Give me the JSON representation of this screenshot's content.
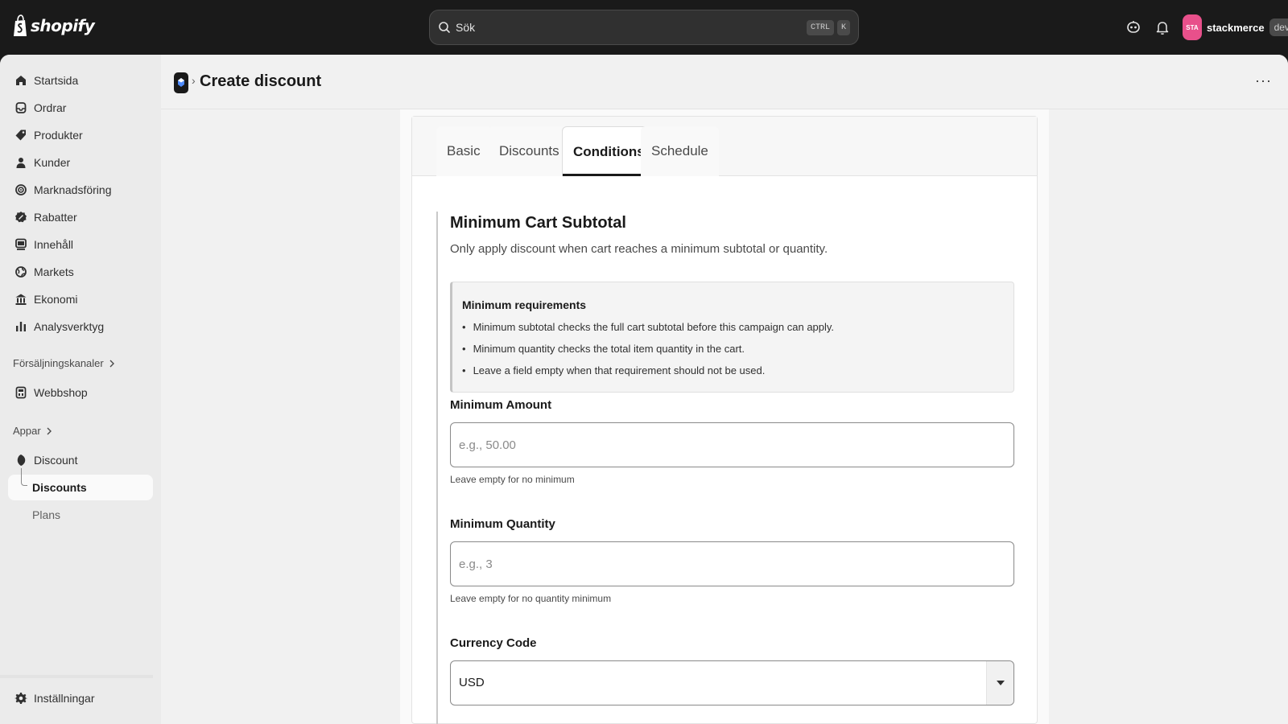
{
  "topbar": {
    "logo_text": "shopify",
    "search_placeholder": "Sök",
    "shortcut_ctrl": "CTRL",
    "shortcut_k": "K",
    "avatar_initials": "STA",
    "store_name": "stackmerce",
    "store_badge": "dev",
    "icons": [
      "assistant-icon",
      "bell-icon",
      "search-icon"
    ]
  },
  "sidebar": {
    "items": [
      {
        "label": "Startsida",
        "icon": "home-icon"
      },
      {
        "label": "Ordrar",
        "icon": "inbox-icon"
      },
      {
        "label": "Produkter",
        "icon": "tag-icon"
      },
      {
        "label": "Kunder",
        "icon": "person-icon"
      },
      {
        "label": "Marknadsföring",
        "icon": "target-icon"
      },
      {
        "label": "Rabatter",
        "icon": "discount-icon"
      },
      {
        "label": "Innehåll",
        "icon": "content-icon"
      },
      {
        "label": "Markets",
        "icon": "globe-icon"
      },
      {
        "label": "Ekonomi",
        "icon": "bank-icon"
      },
      {
        "label": "Analysverktyg",
        "icon": "bar-chart-icon"
      }
    ],
    "sales_channels_label": "Försäljningskanaler",
    "webshop_label": "Webbshop",
    "apps_label": "Appar",
    "app_name": "Discount",
    "app_sub_discounts": "Discounts",
    "app_sub_plans": "Plans",
    "settings_label": "Inställningar"
  },
  "header": {
    "page_title": "Create discount",
    "breadcrumb_separator": "›",
    "more_label": "···"
  },
  "tabs": [
    {
      "label": "Basic",
      "active": false
    },
    {
      "label": "Discounts",
      "active": false
    },
    {
      "label": "Conditions",
      "active": true
    },
    {
      "label": "Schedule",
      "active": false
    }
  ],
  "conditions": {
    "title": "Minimum Cart Subtotal",
    "description": "Only apply discount when cart reaches a minimum subtotal or quantity.",
    "requirements_title": "Minimum requirements",
    "requirements": [
      "Minimum subtotal checks the full cart subtotal before this campaign can apply.",
      "Minimum quantity checks the total item quantity in the cart.",
      "Leave a field empty when that requirement should not be used."
    ],
    "min_amount_label": "Minimum Amount",
    "min_amount_placeholder": "e.g., 50.00",
    "min_amount_help": "Leave empty for no minimum",
    "min_quantity_label": "Minimum Quantity",
    "min_quantity_placeholder": "e.g., 3",
    "min_quantity_help": "Leave empty for no quantity minimum",
    "currency_label": "Currency Code",
    "currency_value": "USD"
  },
  "colors": {
    "topbar_bg": "#1a1a1a",
    "sidebar_bg": "#ebebeb",
    "page_bg": "#f1f1f1",
    "avatar_bg": "#e8508b",
    "active_tab_underline": "#1a1a1a"
  }
}
